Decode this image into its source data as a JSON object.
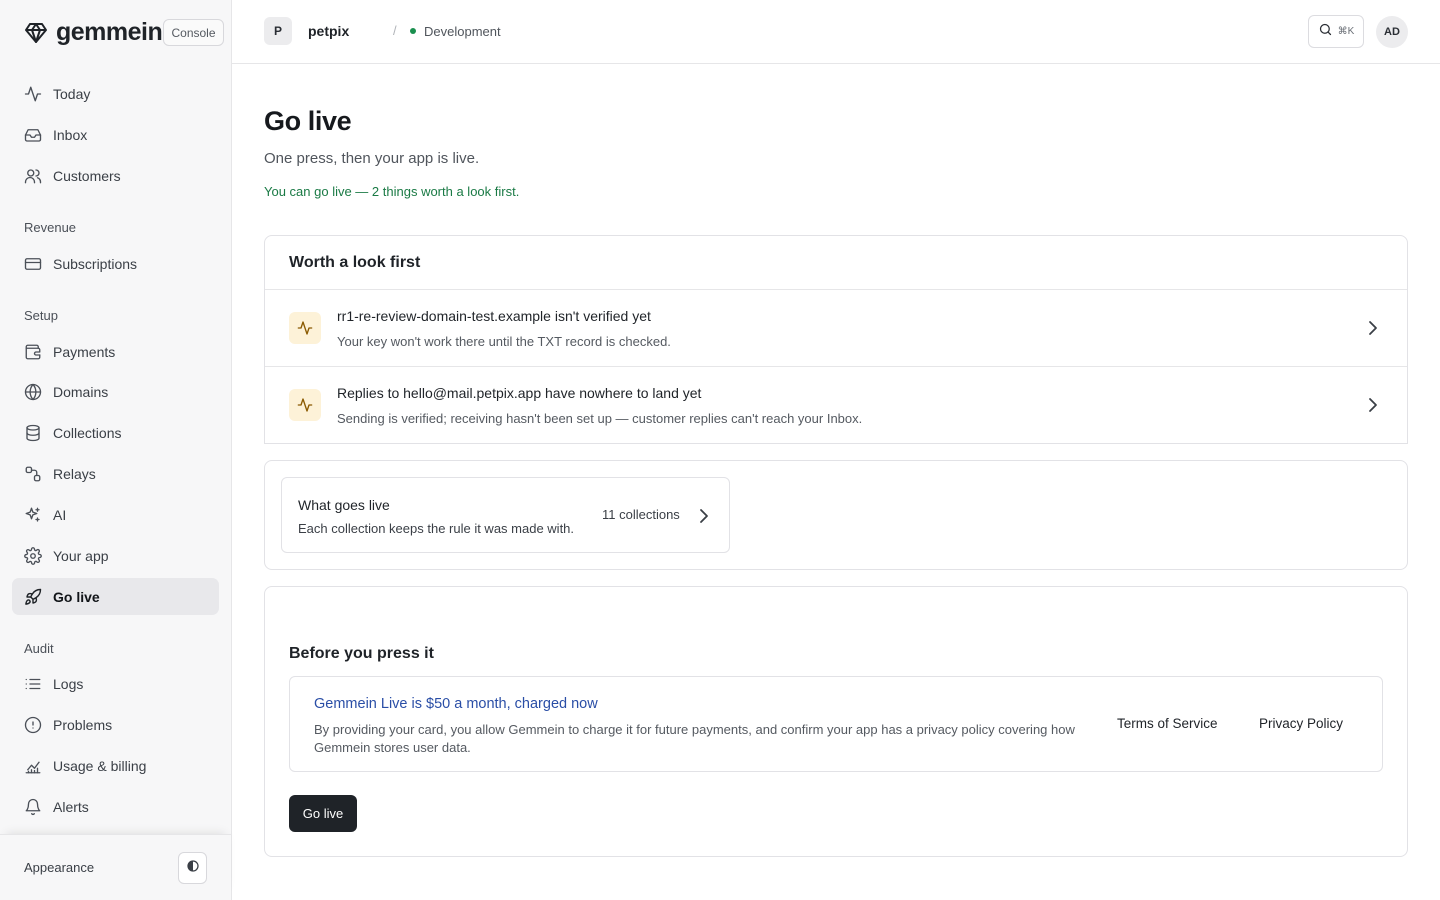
{
  "sidebar": {
    "brand": "gemmein",
    "console_label": "Console",
    "items_top": [
      {
        "label": "Today",
        "icon": "activity-icon"
      },
      {
        "label": "Inbox",
        "icon": "inbox-icon"
      },
      {
        "label": "Customers",
        "icon": "users-icon"
      }
    ],
    "sections": {
      "revenue": "Revenue",
      "setup": "Setup",
      "audit": "Audit"
    },
    "items_revenue": [
      {
        "label": "Subscriptions",
        "icon": "credit-card-icon"
      }
    ],
    "items_setup": [
      {
        "label": "Payments",
        "icon": "wallet-icon"
      },
      {
        "label": "Domains",
        "icon": "globe-icon"
      },
      {
        "label": "Collections",
        "icon": "database-icon"
      },
      {
        "label": "Relays",
        "icon": "route-icon"
      },
      {
        "label": "AI",
        "icon": "sparkles-icon"
      },
      {
        "label": "Your app",
        "icon": "gear-icon"
      },
      {
        "label": "Go live",
        "icon": "rocket-icon",
        "active": true
      }
    ],
    "items_audit": [
      {
        "label": "Logs",
        "icon": "list-icon"
      },
      {
        "label": "Problems",
        "icon": "alert-circle-icon"
      },
      {
        "label": "Usage & billing",
        "icon": "chart-icon"
      },
      {
        "label": "Alerts",
        "icon": "bell-icon"
      }
    ],
    "appearance_label": "Appearance",
    "theme_icon": "contrast-icon"
  },
  "topbar": {
    "project_initial": "P",
    "project_name": "petpix",
    "separator": "/",
    "environment": "Development",
    "environment_color": "#1a8f4e",
    "search_shortcut": "⌘K",
    "user_initials": "AD"
  },
  "main": {
    "title": "Go live",
    "subtitle": "One press, then your app is live.",
    "status": "You can go live — 2 things worth a look first.",
    "status_color": "#1a7a45",
    "worth_look": {
      "title": "Worth a look first",
      "issues": [
        {
          "title": "rr1-re-review-domain-test.example isn't verified yet",
          "description": "Your key won't work there until the TXT record is checked."
        },
        {
          "title": "Replies to hello@mail.petpix.app have nowhere to land yet",
          "description": "Sending is verified; receiving hasn't been set up — customer replies can't reach your Inbox."
        }
      ]
    },
    "what_goes_live": {
      "title": "What goes live",
      "description": "Each collection keeps the rule it was made with.",
      "count": "11 collections"
    },
    "before_press": {
      "title": "Before you press it",
      "price_title": "Gemmein Live is $50 a month, charged now",
      "price_description": "By providing your card, you allow Gemmein to charge it for future payments, and confirm your app has a privacy policy covering how Gemmein stores user data.",
      "terms_link": "Terms of Service",
      "privacy_link": "Privacy Policy",
      "button_label": "Go live"
    }
  }
}
